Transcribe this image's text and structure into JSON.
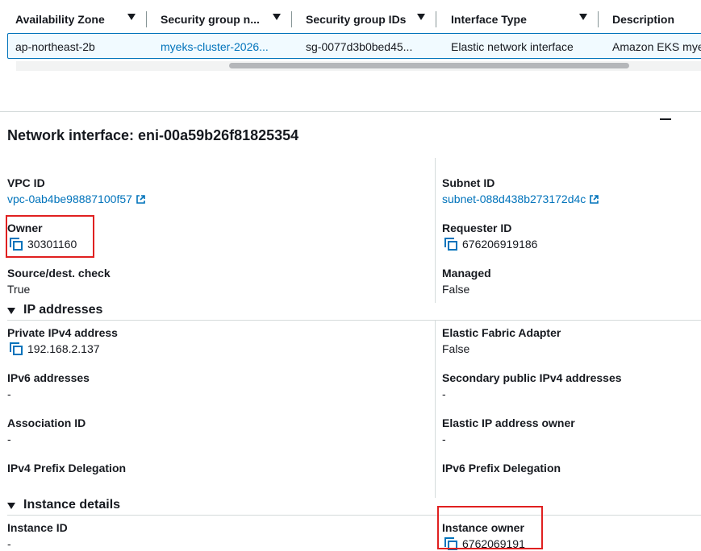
{
  "table": {
    "columns": [
      {
        "label": "Availability Zone"
      },
      {
        "label": "Security group n..."
      },
      {
        "label": "Security group IDs"
      },
      {
        "label": "Interface Type"
      },
      {
        "label": "Description"
      }
    ],
    "row": {
      "availability_zone": "ap-northeast-2b",
      "security_group_name": "myeks-cluster-2026...",
      "security_group_ids": "sg-0077d3b0bed45...",
      "interface_type": "Elastic network interface",
      "description": "Amazon EKS mye"
    }
  },
  "panel": {
    "title": "Network interface: eni-00a59b26f81825354",
    "vpc_id": {
      "label": "VPC ID",
      "value": "vpc-0ab4be98887100f57"
    },
    "subnet_id": {
      "label": "Subnet ID",
      "value": "subnet-088d438b273172d4c"
    },
    "owner": {
      "label": "Owner",
      "value": "30301160"
    },
    "requester_id": {
      "label": "Requester ID",
      "value": "676206919186"
    },
    "source_dest_check": {
      "label": "Source/dest. check",
      "value": "True"
    },
    "managed": {
      "label": "Managed",
      "value": "False"
    }
  },
  "ip_section": {
    "title": "IP addresses",
    "private_ipv4": {
      "label": "Private IPv4 address",
      "value": "192.168.2.137"
    },
    "efa": {
      "label": "Elastic Fabric Adapter",
      "value": "False"
    },
    "ipv6": {
      "label": "IPv6 addresses",
      "value": "-"
    },
    "secondary_public_ipv4": {
      "label": "Secondary public IPv4 addresses",
      "value": "-"
    },
    "association_id": {
      "label": "Association ID",
      "value": "-"
    },
    "eip_owner": {
      "label": "Elastic IP address owner",
      "value": "-"
    },
    "ipv4_prefix": {
      "label": "IPv4 Prefix Delegation"
    },
    "ipv6_prefix": {
      "label": "IPv6 Prefix Delegation"
    }
  },
  "instance_section": {
    "title": "Instance details",
    "instance_id": {
      "label": "Instance ID",
      "value": "-"
    },
    "instance_owner": {
      "label": "Instance owner",
      "value": "6762069191"
    }
  },
  "colors": {
    "link": "#0073bb",
    "highlight_box": "#e02020",
    "selected_row_bg": "#f1faff"
  },
  "icons": [
    "sort-down-icon",
    "external-link-icon",
    "copy-icon",
    "caret-down-icon",
    "minimize-icon"
  ]
}
